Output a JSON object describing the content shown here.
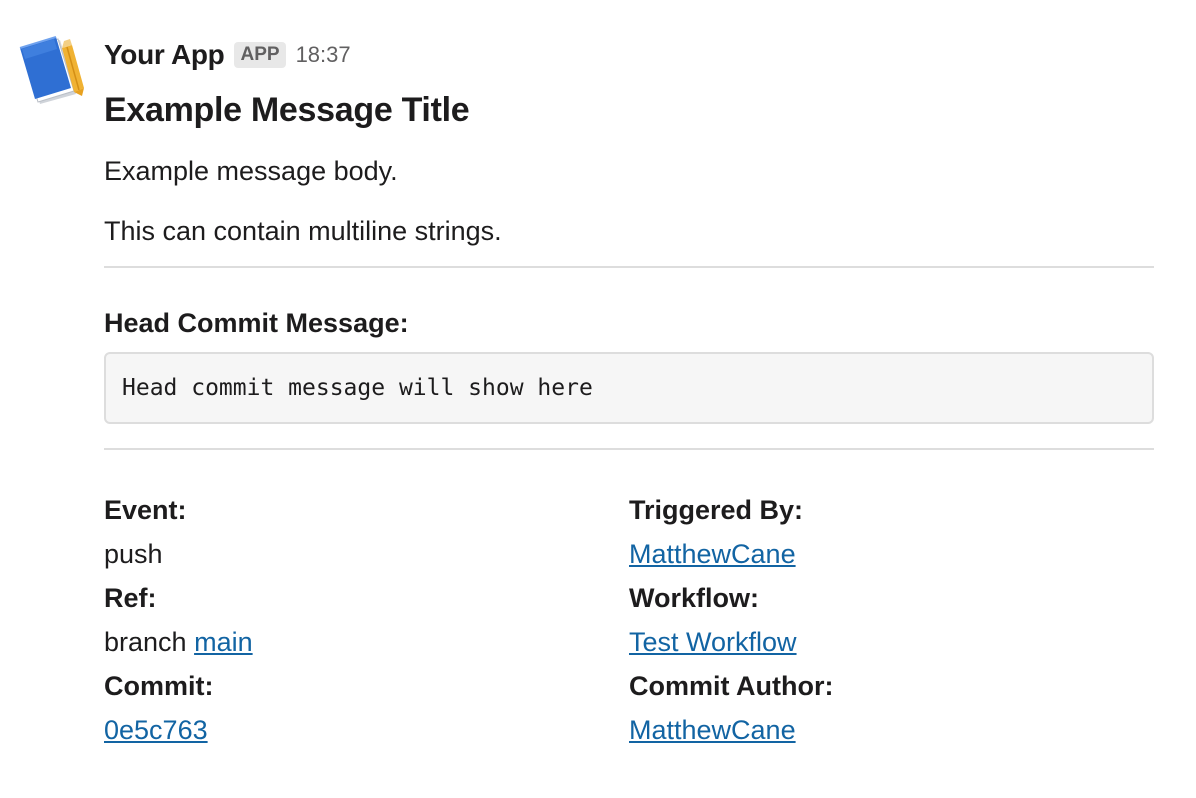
{
  "message": {
    "app_name": "Your App",
    "badge": "APP",
    "timestamp": "18:37",
    "title": "Example Message Title",
    "body_lines": [
      "Example message body.",
      "This can contain multiline strings."
    ],
    "head_commit_label": "Head Commit Message:",
    "head_commit_message": "Head commit message will show here"
  },
  "fields": {
    "event": {
      "label": "Event:",
      "value": "push"
    },
    "ref": {
      "label": "Ref:",
      "prefix": "branch",
      "link": "main"
    },
    "commit": {
      "label": "Commit:",
      "link": "0e5c763"
    },
    "triggered_by": {
      "label": "Triggered By:",
      "link": "MatthewCane"
    },
    "workflow": {
      "label": "Workflow:",
      "link": "Test Workflow"
    },
    "commit_author": {
      "label": "Commit Author:",
      "link": "MatthewCane"
    }
  },
  "colors": {
    "link": "#1264a3",
    "text": "#1d1c1d",
    "muted": "#616061",
    "divider": "#dddddd",
    "code_bg": "#f6f6f6"
  },
  "icons": {
    "avatar": "blue-notebook-icon"
  }
}
